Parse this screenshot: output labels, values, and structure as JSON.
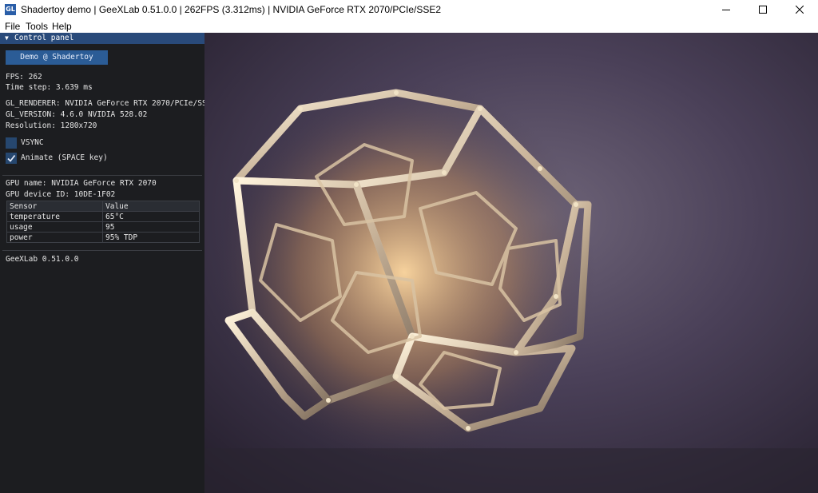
{
  "window": {
    "title": "Shadertoy demo | GeeXLab 0.51.0.0 | 262FPS (3.312ms) | NVIDIA GeForce RTX 2070/PCIe/SSE2",
    "icon_text": "GL"
  },
  "menu": {
    "items": [
      "File",
      "Tools",
      "Help"
    ]
  },
  "panel": {
    "title": "Control panel",
    "demo_button": "Demo @ Shadertoy",
    "fps": "FPS: 262",
    "time_step": "Time step: 3.639 ms",
    "gl_renderer": "GL_RENDERER: NVIDIA GeForce RTX 2070/PCIe/SS",
    "gl_version": "GL_VERSION: 4.6.0 NVIDIA 528.02",
    "resolution": "Resolution: 1280x720",
    "vsync": {
      "label": "VSYNC",
      "checked": false
    },
    "animate": {
      "label": "Animate (SPACE key)",
      "checked": true
    },
    "gpu_name": "GPU name: NVIDIA GeForce RTX 2070",
    "gpu_device": "GPU device ID: 10DE-1F02",
    "table": {
      "headers": [
        "Sensor",
        "Value"
      ],
      "rows": [
        [
          "temperature",
          "65°C"
        ],
        [
          "usage",
          "95"
        ],
        [
          "power",
          "95% TDP"
        ]
      ]
    },
    "footer": "GeeXLab 0.51.0.0"
  },
  "colors": {
    "panel_bg": "#1c1d20",
    "header_blue": "#294a7a",
    "button_blue": "#2b5c96"
  }
}
